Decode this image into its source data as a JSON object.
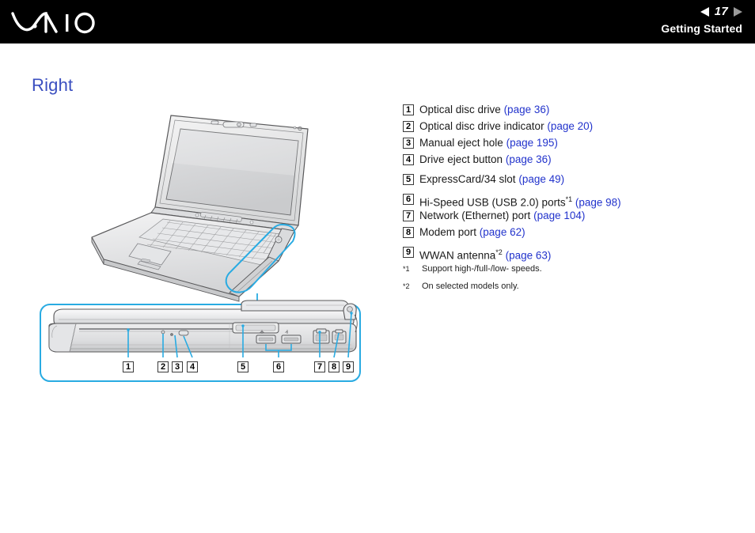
{
  "header": {
    "logo_name": "vaio-logo",
    "page_number": "17",
    "prev_arrow": "left-triangle-icon",
    "next_arrow": "right-triangle-icon",
    "section_title": "Getting Started"
  },
  "page": {
    "title": "Right"
  },
  "legend": {
    "items": [
      {
        "num": "1",
        "label": "Optical disc drive",
        "link": "(page 36)",
        "footnote": ""
      },
      {
        "num": "2",
        "label": "Optical disc drive indicator",
        "link": "(page 20)",
        "footnote": ""
      },
      {
        "num": "3",
        "label": "Manual eject hole",
        "link": "(page 195)",
        "footnote": ""
      },
      {
        "num": "4",
        "label": "Drive eject button",
        "link": "(page 36)",
        "footnote": ""
      },
      {
        "num": "5",
        "label": "ExpressCard/34 slot",
        "link": "(page 49)",
        "footnote": ""
      },
      {
        "num": "6",
        "label": "Hi-Speed USB (USB 2.0) ports",
        "link": "(page 98)",
        "footnote": "*1"
      },
      {
        "num": "7",
        "label": "Network (Ethernet) port",
        "link": "(page 104)",
        "footnote": ""
      },
      {
        "num": "8",
        "label": "Modem port",
        "link": "(page 62)",
        "footnote": ""
      },
      {
        "num": "9",
        "label": "WWAN antenna",
        "link": "(page 63)",
        "footnote": "*2"
      }
    ]
  },
  "footnotes": [
    {
      "mark": "*1",
      "text": "Support high-/full-/low- speeds."
    },
    {
      "mark": "*2",
      "text": "On selected models only."
    }
  ],
  "illustration": {
    "laptop_view_name": "laptop-open-three-quarter-view",
    "detail_view_name": "laptop-right-side-detail-view",
    "callout_numbers": [
      "1",
      "2",
      "3",
      "4",
      "5",
      "6",
      "7",
      "8",
      "9"
    ]
  },
  "colors": {
    "link": "#2233cc",
    "heading": "#3b4fc0",
    "callout": "#29abe2",
    "header_bg": "#000000",
    "line": "#58585a"
  }
}
